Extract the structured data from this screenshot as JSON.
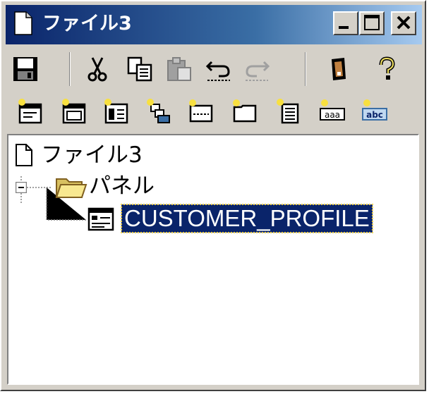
{
  "window": {
    "title": "ファイル3",
    "controls": {
      "minimize_icon": "minimize-icon",
      "maximize_icon": "maximize-icon",
      "close_icon": "close-icon"
    }
  },
  "toolbar1": {
    "items": [
      "save-icon",
      "cut-icon",
      "copy-icon",
      "paste-icon",
      "undo-icon",
      "redo-icon",
      "whats-this-icon",
      "help-icon"
    ],
    "disabled": [
      "paste-icon",
      "redo-icon"
    ]
  },
  "toolbar2": {
    "items": [
      "new-panel-icon",
      "new-window-icon",
      "new-record-icon",
      "new-subfile-icon",
      "new-field-icon",
      "new-group-icon",
      "new-list-icon",
      "new-constant-icon",
      "new-text-icon"
    ]
  },
  "tree": {
    "root": {
      "label": "ファイル3",
      "icon": "document-icon"
    },
    "folder": {
      "label": "パネル",
      "icon": "folder-icon",
      "expanded": true
    },
    "leaf": {
      "label": "CUSTOMER_PROFILE",
      "icon": "panel-icon",
      "selected": true
    }
  },
  "colors": {
    "titlebar_start": "#0a246a",
    "titlebar_end": "#a6caf0",
    "selection": "#0a246a",
    "face": "#d4d0c8"
  }
}
